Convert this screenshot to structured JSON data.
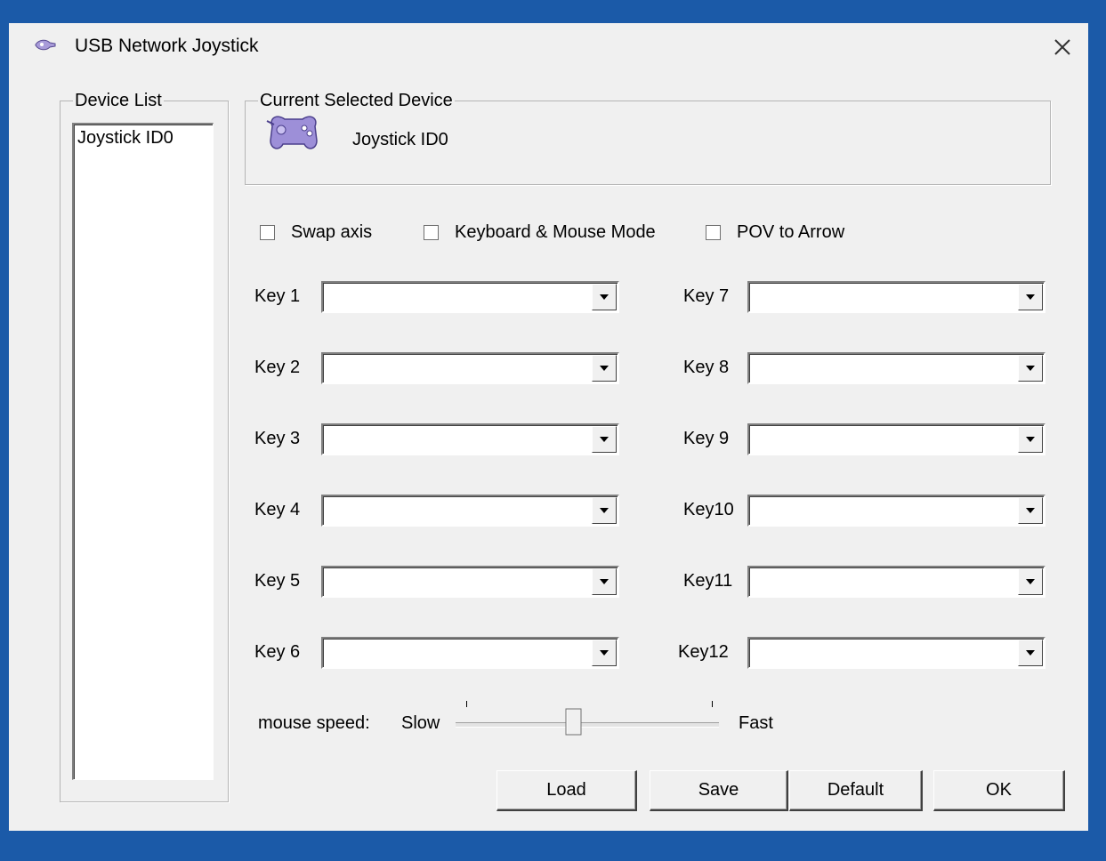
{
  "window": {
    "title": "USB Network Joystick"
  },
  "device_list": {
    "legend": "Device List",
    "items": [
      "Joystick ID0"
    ]
  },
  "current_device": {
    "legend": "Current Selected Device",
    "name": "Joystick ID0",
    "icon": "gamepad-icon"
  },
  "options": {
    "swap_axis": "Swap axis",
    "keyboard_mouse_mode": "Keyboard & Mouse Mode",
    "pov_to_arrow": "POV to Arrow"
  },
  "keys": {
    "left": [
      "Key 1",
      "Key 2",
      "Key 3",
      "Key 4",
      "Key 5",
      "Key 6"
    ],
    "right": [
      "Key 7",
      "Key 8",
      "Key 9",
      "Key10",
      "Key11",
      "Key12"
    ]
  },
  "mouse_speed": {
    "label": "mouse speed:",
    "min_label": "Slow",
    "max_label": "Fast",
    "level": 0.44
  },
  "buttons": {
    "load": "Load",
    "save": "Save",
    "default": "Default",
    "ok": "OK"
  },
  "colors": {
    "desktop": "#1b5aa8",
    "window_bg": "#f0f0f0",
    "gamepad_body": "#9d8fd8"
  }
}
